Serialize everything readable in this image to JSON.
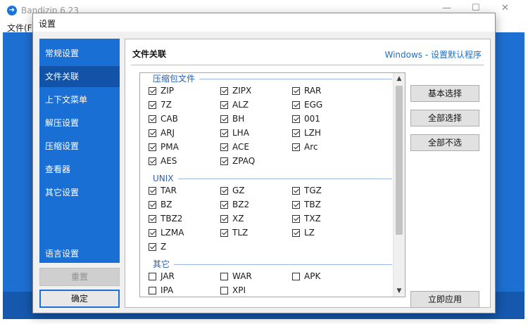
{
  "background_app": {
    "title": "Bandizip 6.23",
    "menu_file": "文件(F)",
    "minimize_glyph": "—",
    "maximize_glyph": "☐",
    "close_glyph": "✕"
  },
  "dialog": {
    "title": "设置",
    "sidebar": [
      {
        "label": "常规设置",
        "active": false
      },
      {
        "label": "文件关联",
        "active": true
      },
      {
        "label": "上下文菜单",
        "active": false
      },
      {
        "label": "解压设置",
        "active": false
      },
      {
        "label": "压缩设置",
        "active": false
      },
      {
        "label": "查看器",
        "active": false
      },
      {
        "label": "其它设置",
        "active": false
      },
      {
        "label": "语言设置",
        "active": false
      }
    ],
    "reset_label": "重置",
    "ok_label": "确定",
    "content": {
      "title": "文件关联",
      "windows_link": "Windows - 设置默认程序",
      "groups": [
        {
          "name": "压缩包文件",
          "items": [
            {
              "label": "ZIP",
              "checked": true
            },
            {
              "label": "ZIPX",
              "checked": true
            },
            {
              "label": "RAR",
              "checked": true
            },
            {
              "label": "7Z",
              "checked": true
            },
            {
              "label": "ALZ",
              "checked": true
            },
            {
              "label": "EGG",
              "checked": true
            },
            {
              "label": "CAB",
              "checked": true
            },
            {
              "label": "BH",
              "checked": true
            },
            {
              "label": "001",
              "checked": true
            },
            {
              "label": "ARJ",
              "checked": true
            },
            {
              "label": "LHA",
              "checked": true
            },
            {
              "label": "LZH",
              "checked": true
            },
            {
              "label": "PMA",
              "checked": true
            },
            {
              "label": "ACE",
              "checked": true
            },
            {
              "label": "Arc",
              "checked": true
            },
            {
              "label": "AES",
              "checked": true
            },
            {
              "label": "ZPAQ",
              "checked": true
            }
          ]
        },
        {
          "name": "UNIX",
          "items": [
            {
              "label": "TAR",
              "checked": true
            },
            {
              "label": "GZ",
              "checked": true
            },
            {
              "label": "TGZ",
              "checked": true
            },
            {
              "label": "BZ",
              "checked": true
            },
            {
              "label": "BZ2",
              "checked": true
            },
            {
              "label": "TBZ",
              "checked": true
            },
            {
              "label": "TBZ2",
              "checked": true
            },
            {
              "label": "XZ",
              "checked": true
            },
            {
              "label": "TXZ",
              "checked": true
            },
            {
              "label": "LZMA",
              "checked": true
            },
            {
              "label": "TLZ",
              "checked": true
            },
            {
              "label": "LZ",
              "checked": true
            },
            {
              "label": "Z",
              "checked": true
            }
          ]
        },
        {
          "name": "其它",
          "items": [
            {
              "label": "JAR",
              "checked": false
            },
            {
              "label": "WAR",
              "checked": false
            },
            {
              "label": "APK",
              "checked": false
            },
            {
              "label": "IPA",
              "checked": false
            },
            {
              "label": "XPI",
              "checked": false
            }
          ]
        }
      ],
      "buttons": {
        "basic_select": "基本选择",
        "select_all": "全部选择",
        "select_none": "全部不选",
        "apply_now": "立即应用"
      }
    }
  }
}
